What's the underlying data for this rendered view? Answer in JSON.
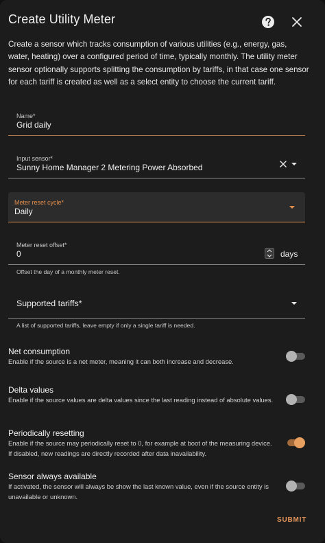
{
  "dialog": {
    "title": "Create Utility Meter",
    "description": "Create a sensor which tracks consumption of various utilities (e.g., energy, gas, water, heating) over a configured period of time, typically monthly. The utility meter sensor optionally supports splitting the consumption by tariffs, in that case one sensor for each tariff is created as well as a select entity to choose the current tariff."
  },
  "fields": {
    "name": {
      "label": "Name*",
      "value": "Grid daily"
    },
    "input_sensor": {
      "label": "Input sensor*",
      "value": "Sunny Home Manager 2 Metering Power Absorbed"
    },
    "reset_cycle": {
      "label": "Meter reset cycle*",
      "value": "Daily"
    },
    "reset_offset": {
      "label": "Meter reset offset*",
      "value": "0",
      "unit": "days",
      "helper": "Offset the day of a monthly meter reset."
    },
    "tariffs": {
      "label": "Supported tariffs*",
      "helper": "A list of supported tariffs, leave empty if only a single tariff is needed."
    }
  },
  "toggles": [
    {
      "title": "Net consumption",
      "description": "Enable if the source is a net meter, meaning it can both increase and decrease.",
      "checked": false
    },
    {
      "title": "Delta values",
      "description": "Enable if the source values are delta values since the last reading instead of absolute values.",
      "checked": false
    },
    {
      "title": "Periodically resetting",
      "description": "Enable if the source may periodically reset to 0, for example at boot of the measuring device. If disabled, new readings are directly recorded after data inavailability.",
      "checked": true
    },
    {
      "title": "Sensor always available",
      "description": "If activated, the sensor will always be show the last known value, even if the source entity is unavailable or unknown.",
      "checked": false
    }
  ],
  "actions": {
    "submit_label": "SUBMIT"
  },
  "icons": {
    "help": "help-circle-icon",
    "close": "close-icon",
    "clear": "clear-icon",
    "dropdown": "chevron-down-icon"
  },
  "colors": {
    "accent": "#e38d4a",
    "switch_on_thumb": "#e8a060",
    "background": "#1c1c1c"
  }
}
